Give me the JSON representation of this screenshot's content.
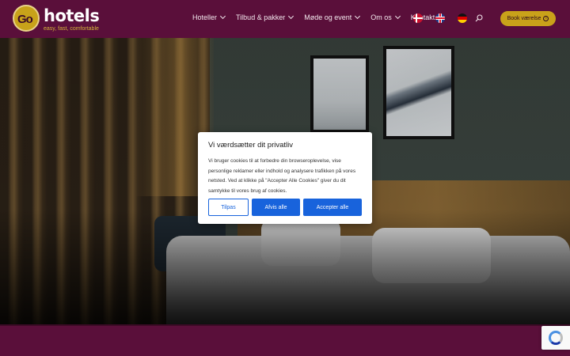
{
  "brand": {
    "logo_mark": "Go",
    "name": "hotels",
    "tagline": "easy, fast, comfortable"
  },
  "nav": {
    "items": [
      {
        "label": "Hoteller",
        "has_dropdown": true
      },
      {
        "label": "Tilbud & pakker",
        "has_dropdown": true
      },
      {
        "label": "Møde og event",
        "has_dropdown": true
      },
      {
        "label": "Om os",
        "has_dropdown": true
      },
      {
        "label": "Kontakt",
        "has_dropdown": false
      }
    ],
    "languages": [
      "Dansk",
      "English",
      "Deutsch"
    ],
    "search_icon": "search-icon",
    "book_button_label": "Book værelse"
  },
  "cookie_dialog": {
    "title": "Vi værdsætter dit privatliv",
    "text": "Vi bruger cookies til at forbedre din browseroplevelse, vise personlige reklamer eller indhold og analysere trafikken på vores netsted. Ved at klikke på \"Accepter Alle Cookies\" giver du dit samtykke til vores brug af cookies.",
    "buttons": {
      "customize": "Tilpas",
      "reject": "Afvis alle",
      "accept": "Accepter alle"
    }
  },
  "colors": {
    "brand_purple": "#5a0f3a",
    "brand_gold": "#c9a21a",
    "cookie_blue": "#1863dc"
  }
}
